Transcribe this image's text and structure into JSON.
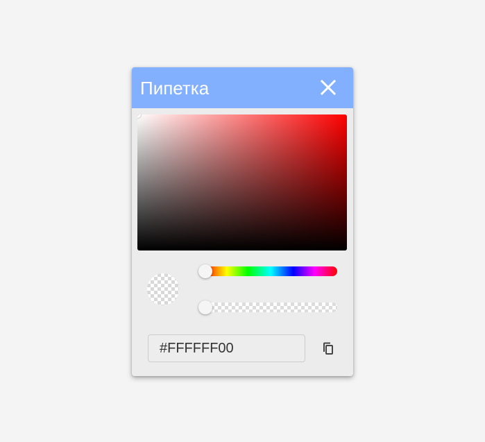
{
  "dialog": {
    "title": "Пипетка",
    "header_color": "#82b0ff"
  },
  "icons": {
    "close": "close-icon",
    "copy": "copy-icon"
  },
  "color_picker": {
    "hue": 0,
    "hue_color": "#ff0000",
    "saturation": 0,
    "value": 1,
    "alpha": 0
  },
  "hex_field": {
    "value": "#FFFFFF00"
  }
}
